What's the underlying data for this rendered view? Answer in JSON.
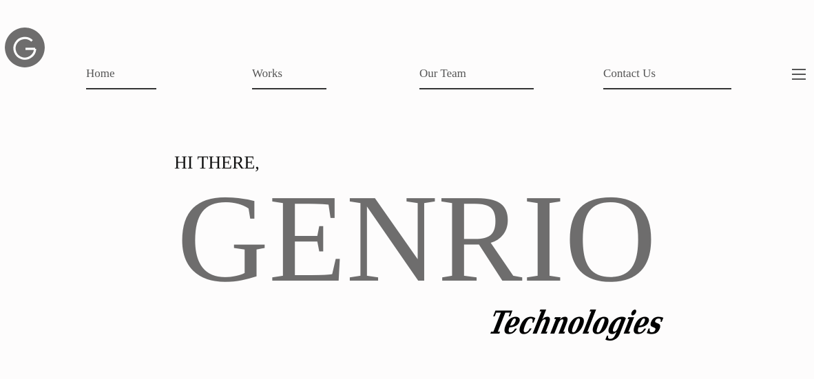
{
  "logo": {
    "letter": "G",
    "icon": "genrio-g-logo-icon",
    "background": "#6e6d6d",
    "foreground": "#ffffff"
  },
  "nav": {
    "items": [
      {
        "label": "Home"
      },
      {
        "label": "Works"
      },
      {
        "label": "Our Team"
      },
      {
        "label": "Contact Us"
      }
    ],
    "menu_icon": "hamburger-menu-icon",
    "underline_color": "#333333",
    "text_color": "#555555"
  },
  "hero": {
    "greeting": "HI THERE,",
    "brand_name": "GENRIO",
    "brand_color": "#6e6d6d",
    "tagline": "Technologies",
    "tagline_color": "#000000"
  }
}
